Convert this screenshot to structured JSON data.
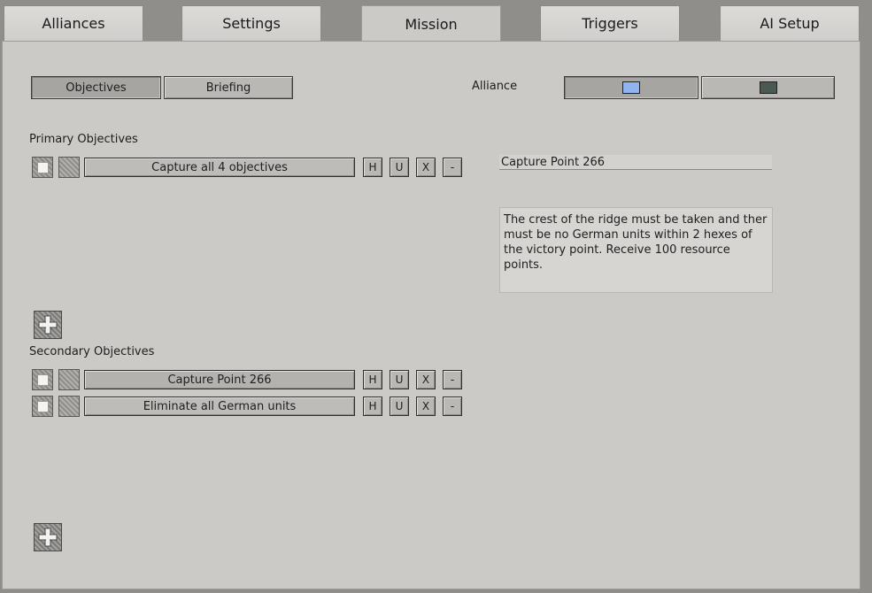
{
  "tabs": [
    {
      "label": "Alliances"
    },
    {
      "label": "Settings"
    },
    {
      "label": "Mission"
    },
    {
      "label": "Triggers"
    },
    {
      "label": "AI Setup"
    }
  ],
  "subtabs": {
    "objectives": "Objectives",
    "briefing": "Briefing"
  },
  "alliance": {
    "label": "Alliance",
    "colors": [
      "#8fb4f0",
      "#4a5a52"
    ]
  },
  "primary": {
    "heading": "Primary Objectives",
    "items": [
      {
        "label": "Capture all 4 objectives"
      }
    ]
  },
  "secondary": {
    "heading": "Secondary Objectives",
    "items": [
      {
        "label": "Capture Point 266"
      },
      {
        "label": "Eliminate all German units"
      }
    ]
  },
  "row_buttons": {
    "h": "H",
    "u": "U",
    "x": "X",
    "minus": "-"
  },
  "detail": {
    "title": "Capture Point 266",
    "description": "The crest of the ridge must be taken and ther must be no German units within 2 hexes of the victory point. Receive 100 resource points."
  }
}
